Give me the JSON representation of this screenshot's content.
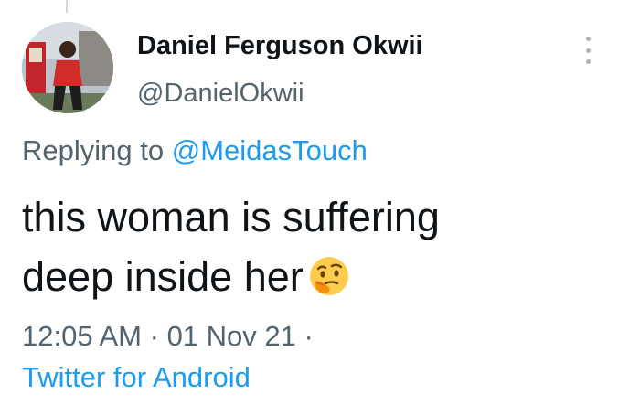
{
  "tweet": {
    "author": {
      "display_name": "Daniel Ferguson Okwii",
      "handle": "@DanielOkwii"
    },
    "reply": {
      "prefix": "Replying to",
      "mention": "@MeidasTouch"
    },
    "text_lines": [
      "this woman is suffering",
      "deep inside her"
    ],
    "emoji": "thinking-face",
    "time": "12:05 AM",
    "date": "01 Nov 21",
    "separator": "·",
    "source": "Twitter for Android"
  },
  "colors": {
    "text_primary": "#0f1419",
    "text_secondary": "#536471",
    "accent": "#1d9bf0",
    "background": "#ffffff"
  },
  "icons": {
    "more": "more-vertical-icon",
    "emoji": "thinking-face-icon"
  }
}
